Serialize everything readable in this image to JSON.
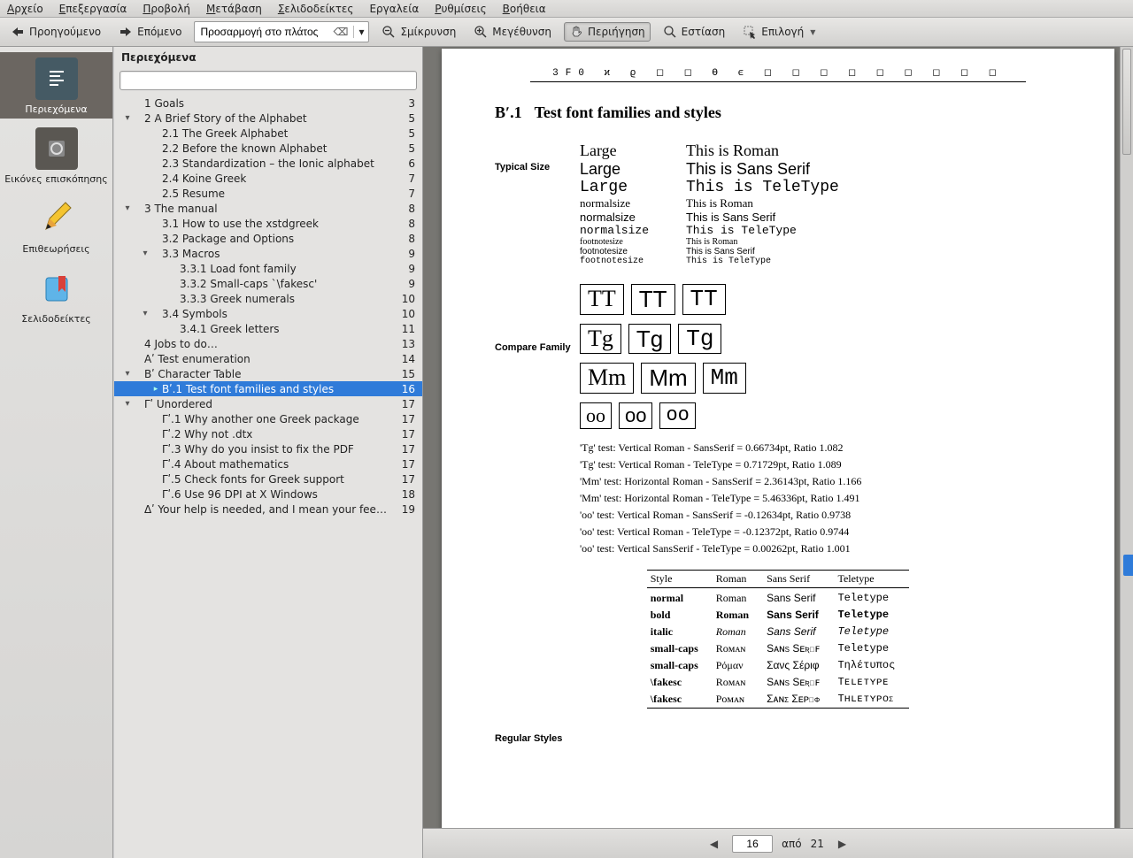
{
  "menu": {
    "file": "Αρχείο",
    "edit": "Επεξεργασία",
    "view": "Προβολή",
    "go": "Μετάβαση",
    "bookmarks": "Σελιδοδείκτες",
    "tools": "Εργαλεία",
    "settings": "Ρυθμίσεις",
    "help": "Βοήθεια"
  },
  "tb": {
    "prev": "Προηγούμενο",
    "next": "Επόμενο",
    "zoom": "Προσαρμογή στο πλάτος",
    "zoomout": "Σμίκρυνση",
    "zoomin": "Μεγέθυνση",
    "browse": "Περιήγηση",
    "focus": "Εστίαση",
    "select": "Επιλογή"
  },
  "sidebar": {
    "contents": "Περιεχόμενα",
    "thumbs": "Εικόνες επισκόπησης",
    "reviews": "Επιθεωρήσεις",
    "bookmarks": "Σελιδοδείκτες"
  },
  "panel": {
    "title": "Περιεχόμενα"
  },
  "toc": [
    {
      "d": 1,
      "tw": "",
      "t": "1 Goals",
      "p": 3
    },
    {
      "d": 1,
      "tw": "▾",
      "t": "2 A Brief Story of the Alphabet",
      "p": 5
    },
    {
      "d": 2,
      "tw": "",
      "t": "2.1 The Greek Alphabet",
      "p": 5
    },
    {
      "d": 2,
      "tw": "",
      "t": "2.2 Before the known Alphabet",
      "p": 5
    },
    {
      "d": 2,
      "tw": "",
      "t": "2.3 Standardization – the Ionic alphabet",
      "p": 6
    },
    {
      "d": 2,
      "tw": "",
      "t": "2.4 Koine Greek",
      "p": 7
    },
    {
      "d": 2,
      "tw": "",
      "t": "2.5 Resume",
      "p": 7
    },
    {
      "d": 1,
      "tw": "▾",
      "t": "3 The manual",
      "p": 8
    },
    {
      "d": 2,
      "tw": "",
      "t": "3.1 How to use the xstdgreek",
      "p": 8
    },
    {
      "d": 2,
      "tw": "",
      "t": "3.2 Package and Options",
      "p": 8
    },
    {
      "d": 2,
      "tw": "▾",
      "t": "3.3 Macros",
      "p": 9
    },
    {
      "d": 3,
      "tw": "",
      "t": "3.3.1 Load font family",
      "p": 9
    },
    {
      "d": 3,
      "tw": "",
      "t": "3.3.2 Small-caps `\\fakesc'",
      "p": 9
    },
    {
      "d": 3,
      "tw": "",
      "t": "3.3.3 Greek numerals",
      "p": 10
    },
    {
      "d": 2,
      "tw": "▾",
      "t": "3.4 Symbols",
      "p": 10
    },
    {
      "d": 3,
      "tw": "",
      "t": "3.4.1 Greek letters",
      "p": 11
    },
    {
      "d": 1,
      "tw": "",
      "t": "4 Jobs to do…",
      "p": 13
    },
    {
      "d": 1,
      "tw": "",
      "t": "Αʹ Test enumeration",
      "p": 14
    },
    {
      "d": 1,
      "tw": "▾",
      "t": "Βʹ Character Table",
      "p": 15
    },
    {
      "d": 2,
      "tw": "",
      "t": "Βʹ.1 Test font families and styles",
      "p": 16,
      "sel": true,
      "b": "▸"
    },
    {
      "d": 1,
      "tw": "▾",
      "t": "Γʹ Unordered",
      "p": 17
    },
    {
      "d": 2,
      "tw": "",
      "t": "Γʹ.1 Why another one Greek package",
      "p": 17
    },
    {
      "d": 2,
      "tw": "",
      "t": "Γʹ.2 Why not .dtx",
      "p": 17
    },
    {
      "d": 2,
      "tw": "",
      "t": "Γʹ.3 Why do you insist to fix the PDF",
      "p": 17
    },
    {
      "d": 2,
      "tw": "",
      "t": "Γʹ.4 About mathematics",
      "p": 17
    },
    {
      "d": 2,
      "tw": "",
      "t": "Γʹ.5 Check fonts for Greek support",
      "p": 17
    },
    {
      "d": 2,
      "tw": "",
      "t": "Γʹ.6 Use 96 DPI at X Windows",
      "p": 18
    },
    {
      "d": 1,
      "tw": "",
      "t": "Δʹ Your help is needed, and I mean your feedback",
      "p": 19
    }
  ],
  "chart_data": {
    "type": "table",
    "title": "Βʹ.1   Test font families and styles",
    "header_hex": "3F0 ϰ ϱ ◻ ◻ ϴ ϵ ◻ ◻ ◻ ◻ ◻ ◻ ◻ ◻ ◻",
    "typical_size": [
      {
        "label": "Large",
        "class": "roman",
        "text": "This is Roman",
        "size": "Large"
      },
      {
        "label": "Large",
        "class": "sans",
        "text": "This is Sans Serif",
        "size": "Large"
      },
      {
        "label": "Large",
        "class": "mono",
        "text": "This is TeleType",
        "size": "Large"
      },
      {
        "label": "normalsize",
        "class": "roman",
        "text": "This is Roman",
        "size": "normalsize"
      },
      {
        "label": "normalsize",
        "class": "sans",
        "text": "This is Sans Serif",
        "size": "normalsize"
      },
      {
        "label": "normalsize",
        "class": "mono",
        "text": "This is TeleType",
        "size": "normalsize"
      },
      {
        "label": "footnotesize",
        "class": "roman",
        "text": "This is Roman",
        "size": "footnotesize"
      },
      {
        "label": "footnotesize",
        "class": "sans",
        "text": "This is Sans Serif",
        "size": "footnotesize"
      },
      {
        "label": "footnotesize",
        "class": "mono",
        "text": "This is TeleType",
        "size": "footnotesize"
      }
    ],
    "compare_rows": [
      [
        "TT",
        "TT",
        "TT"
      ],
      [
        "Tg",
        "Tg",
        "Tg"
      ],
      [
        "Mm",
        "Mm",
        "Mm"
      ],
      [
        "oo",
        "oo",
        "oo"
      ]
    ],
    "tests": [
      "'Tg' test: Vertical Roman - SansSerif = 0.66734pt, Ratio 1.082",
      "'Tg' test: Vertical Roman - TeleType = 0.71729pt, Ratio 1.089",
      "'Mm' test: Horizontal Roman - SansSerif = 2.36143pt, Ratio 1.166",
      "'Mm' test: Horizontal Roman - TeleType = 5.46336pt, Ratio 1.491",
      "'oo' test: Vertical Roman - SansSerif = -0.12634pt, Ratio 0.9738",
      "'oo' test: Vertical Roman - TeleType = -0.12372pt, Ratio 0.9744",
      "'oo' test: Vertical SansSerif - TeleType = 0.00262pt, Ratio 1.001"
    ],
    "style_table": {
      "head": [
        "Style",
        "Roman",
        "Sans Serif",
        "Teletype"
      ],
      "rows": [
        [
          "normal",
          "Roman",
          "Sans Serif",
          "Teletype"
        ],
        [
          "bold",
          "Roman",
          "Sans Serif",
          "Teletype"
        ],
        [
          "italic",
          "Roman",
          "Sans Serif",
          "Teletype"
        ],
        [
          "small-caps",
          "Rᴏᴍᴀɴ",
          "Sᴀɴs Sᴇʀɪꜰ",
          "Teletype"
        ],
        [
          "small-caps",
          "Ρόμαν",
          "Σανς Σέριφ",
          "Τηλέτυπος"
        ],
        [
          "\\fakesc",
          "Rᴏᴍᴀɴ",
          "Sᴀɴs Sᴇʀɪꜰ",
          "Tᴇʟᴇᴛʏᴘᴇ"
        ],
        [
          "\\fakesc",
          "Ρᴏᴍᴀɴ",
          "Σᴀɴς Σᴇᴩɪφ",
          "Τʜʟᴇᴛʏᴘᴏς"
        ]
      ]
    },
    "labels": {
      "typical": "Typical Size",
      "compare": "Compare Family",
      "regular": "Regular Styles"
    }
  },
  "pager": {
    "page": "16",
    "of_label": "από",
    "total": "21"
  }
}
